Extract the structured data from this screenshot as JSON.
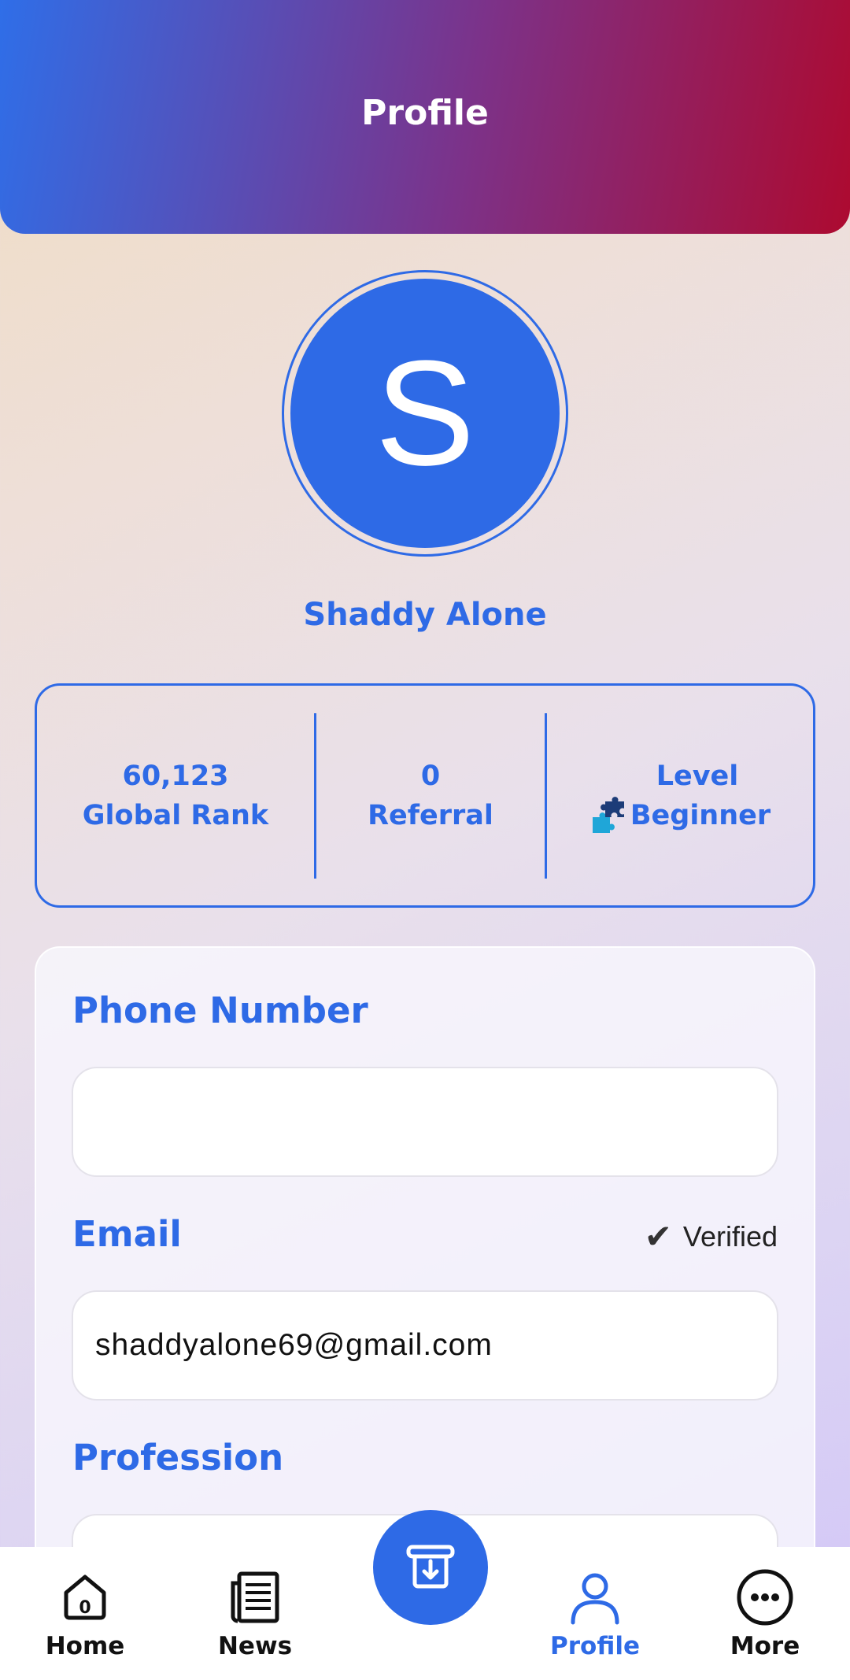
{
  "header": {
    "title": "Profile"
  },
  "profile": {
    "avatar_letter": "S",
    "name": "Shaddy Alone"
  },
  "stats": {
    "global_rank_value": "60,123",
    "global_rank_label": "Global Rank",
    "referral_value": "0",
    "referral_label": "Referral",
    "level_label": "Level",
    "level_value": "Beginner",
    "level_icon": "puzzle-icon"
  },
  "form": {
    "phone_label": "Phone Number",
    "phone_value": "",
    "email_label": "Email",
    "email_status": "Verified",
    "email_value": "shaddyalone69@gmail.com",
    "profession_label": "Profession",
    "profession_value": ""
  },
  "nav": {
    "items": [
      {
        "label": "Home",
        "icon": "home-icon",
        "badge": "0"
      },
      {
        "label": "News",
        "icon": "newspaper-icon"
      },
      {
        "label": "Profile",
        "icon": "user-icon",
        "active": true
      },
      {
        "label": "More",
        "icon": "more-icon"
      }
    ],
    "center_action_icon": "download-receipt-icon"
  },
  "colors": {
    "accent": "#2e6ae6",
    "header_start": "#2f6ee8",
    "header_end": "#ad0a30"
  }
}
